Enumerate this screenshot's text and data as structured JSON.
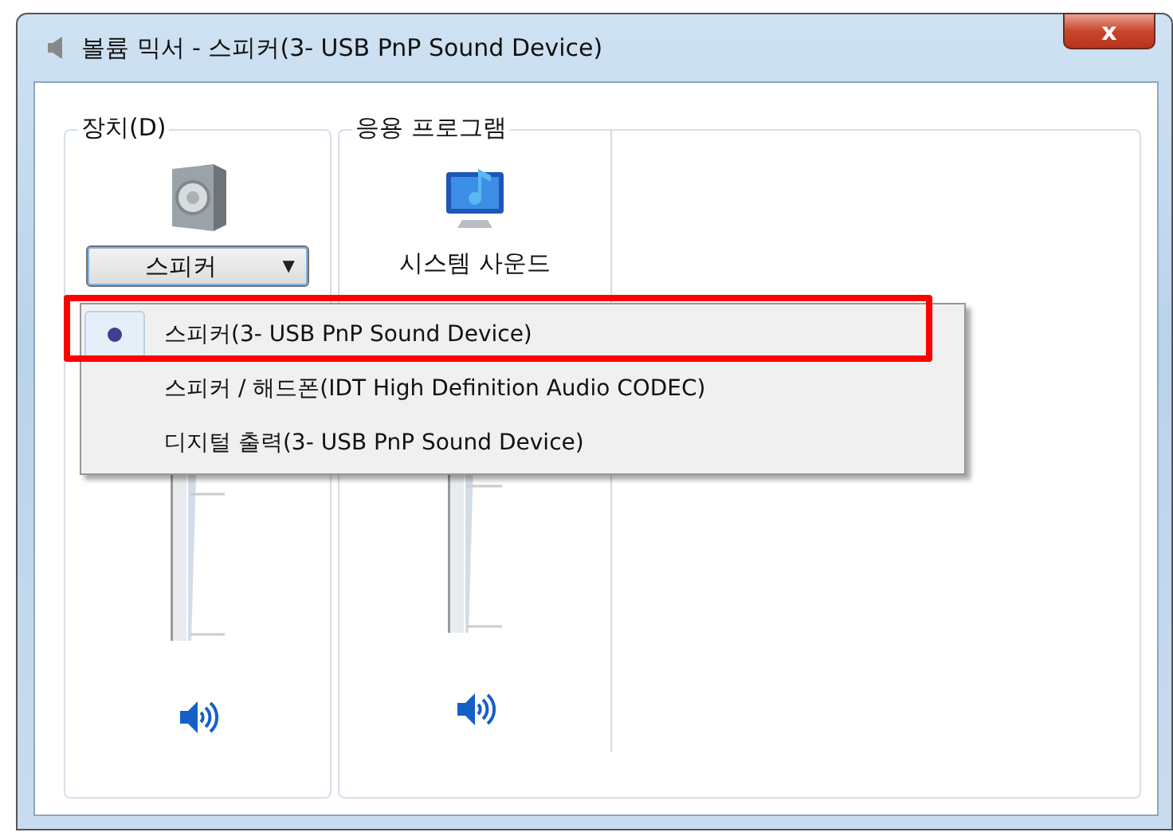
{
  "window": {
    "title": "볼륨 믹서 - 스피커(3- USB PnP Sound Device)",
    "close_label": "x"
  },
  "device_group": {
    "label": "장치(D)",
    "selector": {
      "value": "스피커",
      "caret": "▼",
      "expanded": true
    },
    "speaker": {
      "muted": false
    }
  },
  "app_group": {
    "label": "응용 프로그램",
    "apps": [
      {
        "name": "시스템 사운드",
        "speaker": {
          "muted": false
        }
      }
    ]
  },
  "device_menu": {
    "items": [
      {
        "label": "스피커(3- USB PnP Sound Device)",
        "selected": true,
        "highlighted": true
      },
      {
        "label": "스피커 / 해드폰(IDT High Definition Audio CODEC)",
        "selected": false,
        "highlighted": false
      },
      {
        "label": "디지털 출력(3- USB PnP Sound Device)",
        "selected": false,
        "highlighted": false
      }
    ]
  }
}
